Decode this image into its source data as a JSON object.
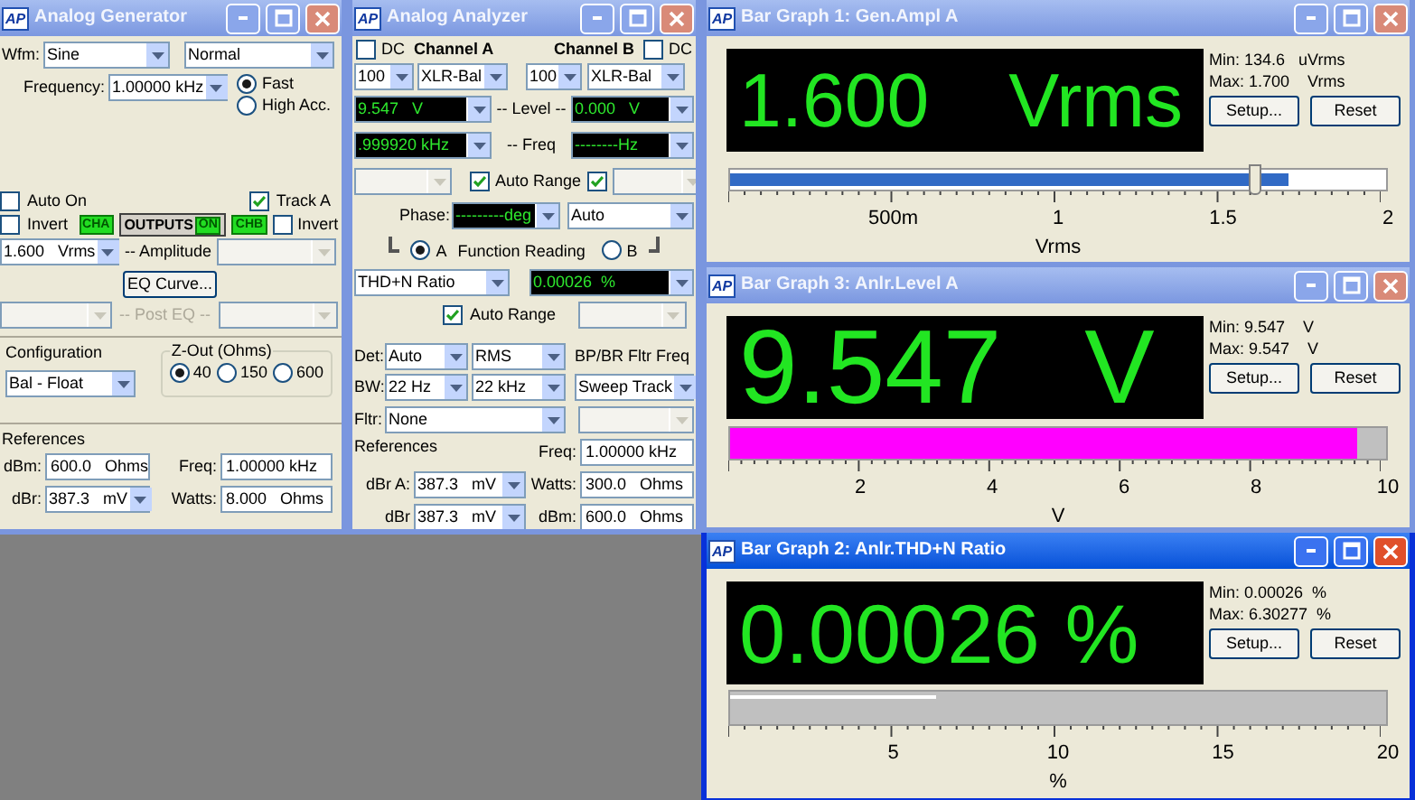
{
  "generator": {
    "title": "Analog Generator",
    "icon_text": "AP",
    "active": false,
    "waveform": {
      "label": "Wfm:",
      "type": "Sine",
      "mode": "Normal"
    },
    "frequency": {
      "label": "Frequency:",
      "value": "1.00000 kHz"
    },
    "accuracy": [
      {
        "label": "Fast",
        "selected": true
      },
      {
        "label": "High Acc.",
        "selected": false
      }
    ],
    "auto_on": {
      "label": "Auto On",
      "checked": false
    },
    "track_a": {
      "label": "Track A",
      "checked": true
    },
    "invert_a": {
      "label": "Invert",
      "checked": false
    },
    "cha": {
      "label": "CHA",
      "on": true
    },
    "outputs": {
      "label": "OUTPUTS",
      "indicator": "ON",
      "on": true
    },
    "chb": {
      "label": "CHB",
      "on": true
    },
    "invert_b": {
      "label": "Invert",
      "checked": false
    },
    "amplitude": {
      "value": "1.600   Vrms",
      "label": "-- Amplitude"
    },
    "eq_button": "EQ Curve...",
    "post_eq": {
      "label": "-- Post EQ --"
    },
    "configuration": {
      "label": "Configuration",
      "value": "Bal - Float"
    },
    "z_out": {
      "label": "Z-Out (Ohms)",
      "options": [
        {
          "label": "40",
          "selected": true
        },
        {
          "label": "150",
          "selected": false
        },
        {
          "label": "600",
          "selected": false
        }
      ]
    },
    "references": {
      "label": "References",
      "fields": [
        {
          "label": "dBm:",
          "value": "600.0   Ohms",
          "kind": "field"
        },
        {
          "label": "Freq:",
          "value": "1.00000 kHz",
          "kind": "field"
        },
        {
          "label": "dBr:",
          "value": "387.3   mV",
          "kind": "combo"
        },
        {
          "label": "Watts:",
          "value": "8.000   Ohms",
          "kind": "field"
        }
      ]
    }
  },
  "analyzer": {
    "title": "Analog Analyzer",
    "icon_text": "AP",
    "active": false,
    "channels": [
      {
        "name": "Channel A",
        "dc": {
          "label": "DC",
          "checked": false
        },
        "range": "100",
        "input": "XLR-Bal",
        "level": "9.547   V",
        "freq": ".999920 kHz",
        "auto_range": true
      },
      {
        "name": "Channel B",
        "dc": {
          "label": "DC",
          "checked": false
        },
        "range": "100",
        "input": "XLR-Bal",
        "level": "0.000   V",
        "freq": "--------Hz",
        "auto_range": true
      }
    ],
    "level_label": "-- Level --",
    "freq_label": "-- Freq",
    "auto_range_label": "Auto Range",
    "phase": {
      "label": "Phase:",
      "value": "---------deg",
      "mode": "Auto"
    },
    "function_reading": {
      "label": "Function Reading",
      "options": [
        {
          "label": "A",
          "selected": true
        },
        {
          "label": "B",
          "selected": false
        }
      ],
      "function": "THD+N Ratio",
      "value": "0.00026  %",
      "auto_range": {
        "label": "Auto Range",
        "checked": true
      }
    },
    "detector": {
      "label": "Det:",
      "values": [
        "Auto",
        "RMS"
      ]
    },
    "bp_label": "BP/BR Fltr Freq",
    "bandwidth": {
      "label": "BW:",
      "values": [
        "22 Hz",
        "22 kHz"
      ],
      "sweep": "Sweep Track"
    },
    "filter": {
      "label": "Fltr:",
      "value": "None"
    },
    "references": {
      "label": "References",
      "freq": {
        "label": "Freq:",
        "value": "1.00000 kHz"
      },
      "fields": [
        {
          "label": "dBr A:",
          "value": "387.3   mV",
          "kind": "combo"
        },
        {
          "label": "Watts:",
          "value": "300.0   Ohms",
          "kind": "field"
        },
        {
          "label": "dBr",
          "value": "387.3   mV",
          "kind": "combo"
        },
        {
          "label": "dBm:",
          "value": "600.0   Ohms",
          "kind": "field"
        }
      ]
    }
  },
  "bar_graphs": [
    {
      "title": "Bar Graph 1: Gen.Ampl A",
      "icon_text": "AP",
      "active": false,
      "reading": "1.600",
      "unit": "Vrms",
      "min": "Min: 134.6   uVrms",
      "max": "Max: 1.700    Vrms",
      "setup": "Setup...",
      "reset": "Reset",
      "bar": {
        "level": 0.85,
        "color": "#316ac5"
      },
      "marker": {
        "kind": "thumb",
        "level": 0.8
      },
      "ticks": [
        "500m",
        "1",
        "1.5",
        "2"
      ],
      "axis_label": "Vrms"
    },
    {
      "title": "Bar Graph 3: Anlr.Level A",
      "icon_text": "AP",
      "active": false,
      "reading": "9.547",
      "unit": "V",
      "min": "Min: 9.547    V",
      "max": "Max: 9.547    V",
      "setup": "Setup...",
      "reset": "Reset",
      "bar": {
        "level": 0.955,
        "color": "#ff00ff"
      },
      "ticks": [
        "2",
        "4",
        "6",
        "8",
        "10"
      ],
      "axis_label": "V"
    },
    {
      "title": "Bar Graph 2: Anlr.THD+N Ratio",
      "icon_text": "AP",
      "active": true,
      "reading": "0.00026",
      "unit": "%",
      "min": "Min: 0.00026  %",
      "max": "Max: 6.30277  %",
      "setup": "Setup...",
      "reset": "Reset",
      "marker": {
        "kind": "line",
        "level": 0.315
      },
      "ticks": [
        "5",
        "10",
        "15",
        "20"
      ],
      "axis_label": "%"
    }
  ]
}
